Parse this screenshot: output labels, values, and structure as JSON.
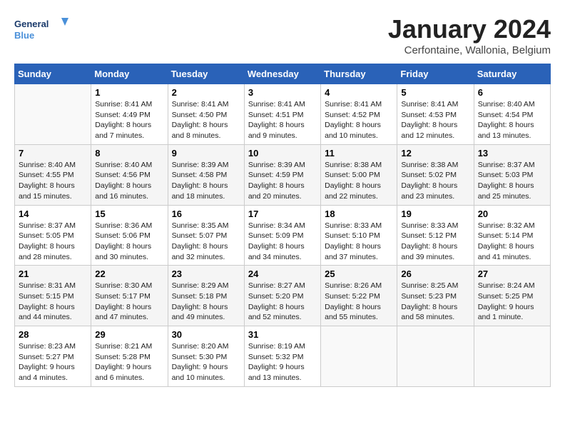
{
  "header": {
    "logo_general": "General",
    "logo_blue": "Blue",
    "title": "January 2024",
    "subtitle": "Cerfontaine, Wallonia, Belgium"
  },
  "columns": [
    "Sunday",
    "Monday",
    "Tuesday",
    "Wednesday",
    "Thursday",
    "Friday",
    "Saturday"
  ],
  "weeks": [
    [
      {
        "day": "",
        "sunrise": "",
        "sunset": "",
        "daylight": ""
      },
      {
        "day": "1",
        "sunrise": "Sunrise: 8:41 AM",
        "sunset": "Sunset: 4:49 PM",
        "daylight": "Daylight: 8 hours and 7 minutes."
      },
      {
        "day": "2",
        "sunrise": "Sunrise: 8:41 AM",
        "sunset": "Sunset: 4:50 PM",
        "daylight": "Daylight: 8 hours and 8 minutes."
      },
      {
        "day": "3",
        "sunrise": "Sunrise: 8:41 AM",
        "sunset": "Sunset: 4:51 PM",
        "daylight": "Daylight: 8 hours and 9 minutes."
      },
      {
        "day": "4",
        "sunrise": "Sunrise: 8:41 AM",
        "sunset": "Sunset: 4:52 PM",
        "daylight": "Daylight: 8 hours and 10 minutes."
      },
      {
        "day": "5",
        "sunrise": "Sunrise: 8:41 AM",
        "sunset": "Sunset: 4:53 PM",
        "daylight": "Daylight: 8 hours and 12 minutes."
      },
      {
        "day": "6",
        "sunrise": "Sunrise: 8:40 AM",
        "sunset": "Sunset: 4:54 PM",
        "daylight": "Daylight: 8 hours and 13 minutes."
      }
    ],
    [
      {
        "day": "7",
        "sunrise": "Sunrise: 8:40 AM",
        "sunset": "Sunset: 4:55 PM",
        "daylight": "Daylight: 8 hours and 15 minutes."
      },
      {
        "day": "8",
        "sunrise": "Sunrise: 8:40 AM",
        "sunset": "Sunset: 4:56 PM",
        "daylight": "Daylight: 8 hours and 16 minutes."
      },
      {
        "day": "9",
        "sunrise": "Sunrise: 8:39 AM",
        "sunset": "Sunset: 4:58 PM",
        "daylight": "Daylight: 8 hours and 18 minutes."
      },
      {
        "day": "10",
        "sunrise": "Sunrise: 8:39 AM",
        "sunset": "Sunset: 4:59 PM",
        "daylight": "Daylight: 8 hours and 20 minutes."
      },
      {
        "day": "11",
        "sunrise": "Sunrise: 8:38 AM",
        "sunset": "Sunset: 5:00 PM",
        "daylight": "Daylight: 8 hours and 22 minutes."
      },
      {
        "day": "12",
        "sunrise": "Sunrise: 8:38 AM",
        "sunset": "Sunset: 5:02 PM",
        "daylight": "Daylight: 8 hours and 23 minutes."
      },
      {
        "day": "13",
        "sunrise": "Sunrise: 8:37 AM",
        "sunset": "Sunset: 5:03 PM",
        "daylight": "Daylight: 8 hours and 25 minutes."
      }
    ],
    [
      {
        "day": "14",
        "sunrise": "Sunrise: 8:37 AM",
        "sunset": "Sunset: 5:05 PM",
        "daylight": "Daylight: 8 hours and 28 minutes."
      },
      {
        "day": "15",
        "sunrise": "Sunrise: 8:36 AM",
        "sunset": "Sunset: 5:06 PM",
        "daylight": "Daylight: 8 hours and 30 minutes."
      },
      {
        "day": "16",
        "sunrise": "Sunrise: 8:35 AM",
        "sunset": "Sunset: 5:07 PM",
        "daylight": "Daylight: 8 hours and 32 minutes."
      },
      {
        "day": "17",
        "sunrise": "Sunrise: 8:34 AM",
        "sunset": "Sunset: 5:09 PM",
        "daylight": "Daylight: 8 hours and 34 minutes."
      },
      {
        "day": "18",
        "sunrise": "Sunrise: 8:33 AM",
        "sunset": "Sunset: 5:10 PM",
        "daylight": "Daylight: 8 hours and 37 minutes."
      },
      {
        "day": "19",
        "sunrise": "Sunrise: 8:33 AM",
        "sunset": "Sunset: 5:12 PM",
        "daylight": "Daylight: 8 hours and 39 minutes."
      },
      {
        "day": "20",
        "sunrise": "Sunrise: 8:32 AM",
        "sunset": "Sunset: 5:14 PM",
        "daylight": "Daylight: 8 hours and 41 minutes."
      }
    ],
    [
      {
        "day": "21",
        "sunrise": "Sunrise: 8:31 AM",
        "sunset": "Sunset: 5:15 PM",
        "daylight": "Daylight: 8 hours and 44 minutes."
      },
      {
        "day": "22",
        "sunrise": "Sunrise: 8:30 AM",
        "sunset": "Sunset: 5:17 PM",
        "daylight": "Daylight: 8 hours and 47 minutes."
      },
      {
        "day": "23",
        "sunrise": "Sunrise: 8:29 AM",
        "sunset": "Sunset: 5:18 PM",
        "daylight": "Daylight: 8 hours and 49 minutes."
      },
      {
        "day": "24",
        "sunrise": "Sunrise: 8:27 AM",
        "sunset": "Sunset: 5:20 PM",
        "daylight": "Daylight: 8 hours and 52 minutes."
      },
      {
        "day": "25",
        "sunrise": "Sunrise: 8:26 AM",
        "sunset": "Sunset: 5:22 PM",
        "daylight": "Daylight: 8 hours and 55 minutes."
      },
      {
        "day": "26",
        "sunrise": "Sunrise: 8:25 AM",
        "sunset": "Sunset: 5:23 PM",
        "daylight": "Daylight: 8 hours and 58 minutes."
      },
      {
        "day": "27",
        "sunrise": "Sunrise: 8:24 AM",
        "sunset": "Sunset: 5:25 PM",
        "daylight": "Daylight: 9 hours and 1 minute."
      }
    ],
    [
      {
        "day": "28",
        "sunrise": "Sunrise: 8:23 AM",
        "sunset": "Sunset: 5:27 PM",
        "daylight": "Daylight: 9 hours and 4 minutes."
      },
      {
        "day": "29",
        "sunrise": "Sunrise: 8:21 AM",
        "sunset": "Sunset: 5:28 PM",
        "daylight": "Daylight: 9 hours and 6 minutes."
      },
      {
        "day": "30",
        "sunrise": "Sunrise: 8:20 AM",
        "sunset": "Sunset: 5:30 PM",
        "daylight": "Daylight: 9 hours and 10 minutes."
      },
      {
        "day": "31",
        "sunrise": "Sunrise: 8:19 AM",
        "sunset": "Sunset: 5:32 PM",
        "daylight": "Daylight: 9 hours and 13 minutes."
      },
      {
        "day": "",
        "sunrise": "",
        "sunset": "",
        "daylight": ""
      },
      {
        "day": "",
        "sunrise": "",
        "sunset": "",
        "daylight": ""
      },
      {
        "day": "",
        "sunrise": "",
        "sunset": "",
        "daylight": ""
      }
    ]
  ]
}
